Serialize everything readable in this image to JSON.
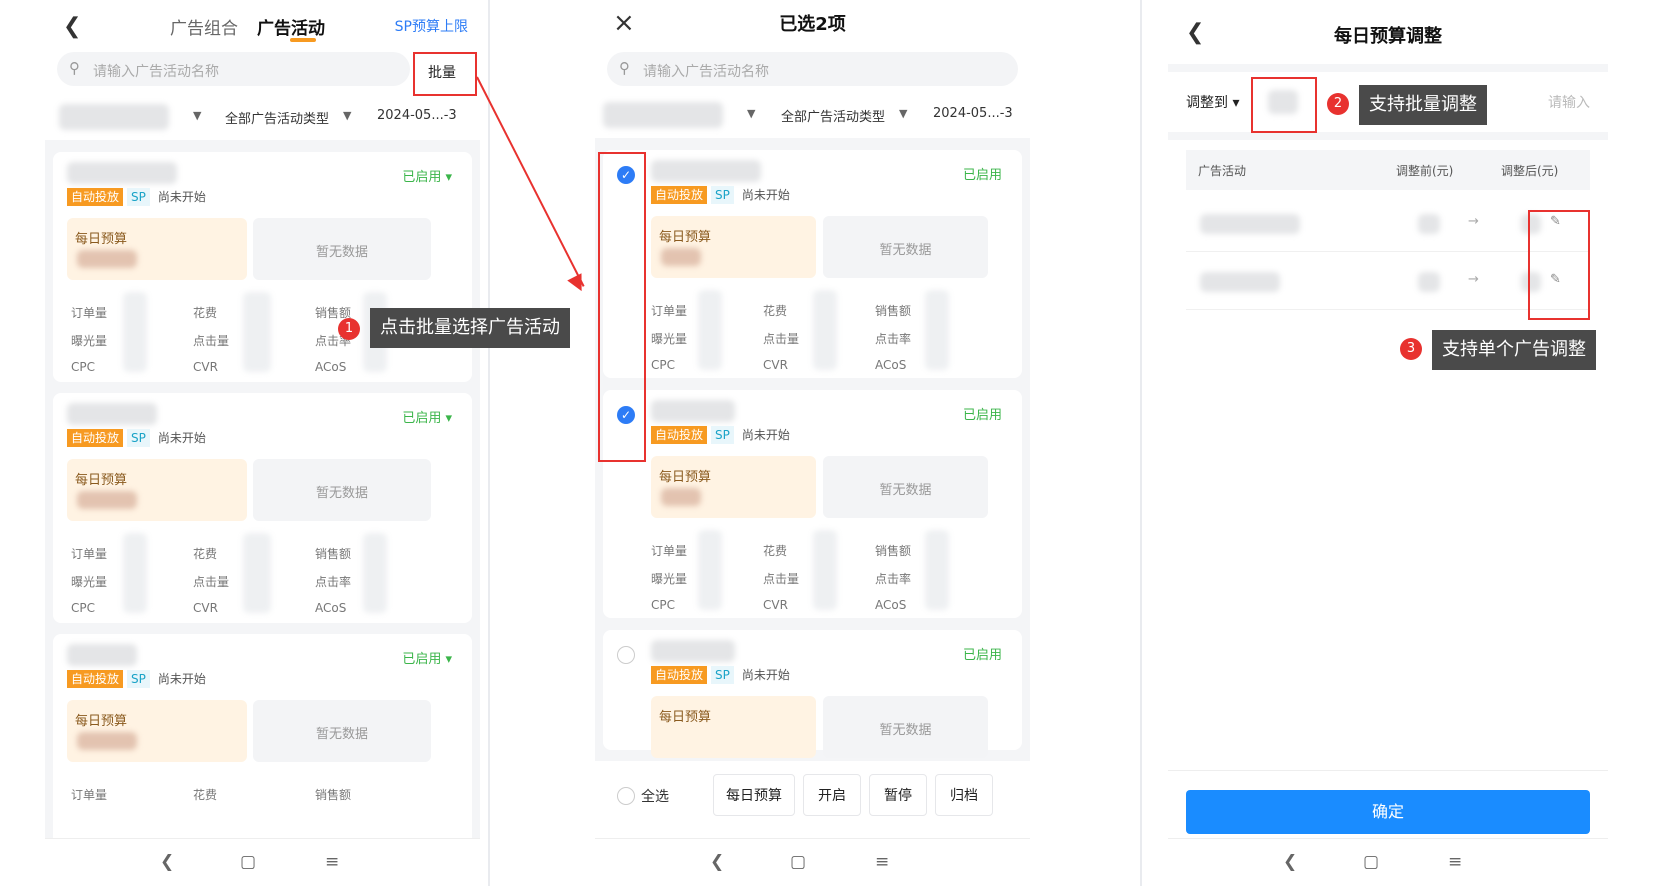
{
  "panel1": {
    "tabs": [
      {
        "label": "广告组合"
      },
      {
        "label": "广告活动"
      }
    ],
    "header_link": "SP预算上限",
    "search_placeholder": "请输入广告活动名称",
    "batch_label": "批量",
    "filter_type": "全部广告活动类型",
    "filter_date": "2024-05...-3"
  },
  "panel2": {
    "title": "已选2项",
    "search_placeholder": "请输入广告活动名称",
    "filter_type": "全部广告活动类型",
    "filter_date": "2024-05...-3",
    "select_all": "全选",
    "actions": [
      "每日预算",
      "开启",
      "暂停",
      "归档"
    ]
  },
  "card": {
    "status": "已启用",
    "tag_auto": "自动投放",
    "tag_sp": "SP",
    "tag_state": "尚未开始",
    "budget_label": "每日预算",
    "nodata": "暂无数据",
    "metrics": [
      "订单量",
      "花费",
      "销售额",
      "曝光量",
      "点击量",
      "点击率",
      "CPC",
      "CVR",
      "ACoS"
    ]
  },
  "panel3": {
    "title": "每日预算调整",
    "adjust_label": "调整到",
    "input_placeholder": "请输入",
    "col_campaign": "广告活动",
    "col_before": "调整前(元)",
    "col_after": "调整后(元)",
    "confirm": "确定"
  },
  "annotations": {
    "a1": {
      "num": "1",
      "text": "点击批量选择广告活动"
    },
    "a2": {
      "num": "2",
      "text": "支持批量调整"
    },
    "a3": {
      "num": "3",
      "text": "支持单个广告调整"
    }
  },
  "colors": {
    "accent": "#2d7cf6",
    "status_green": "#3bb54a",
    "tag_orange": "#f79a21",
    "annotation_red": "#e8322f"
  }
}
